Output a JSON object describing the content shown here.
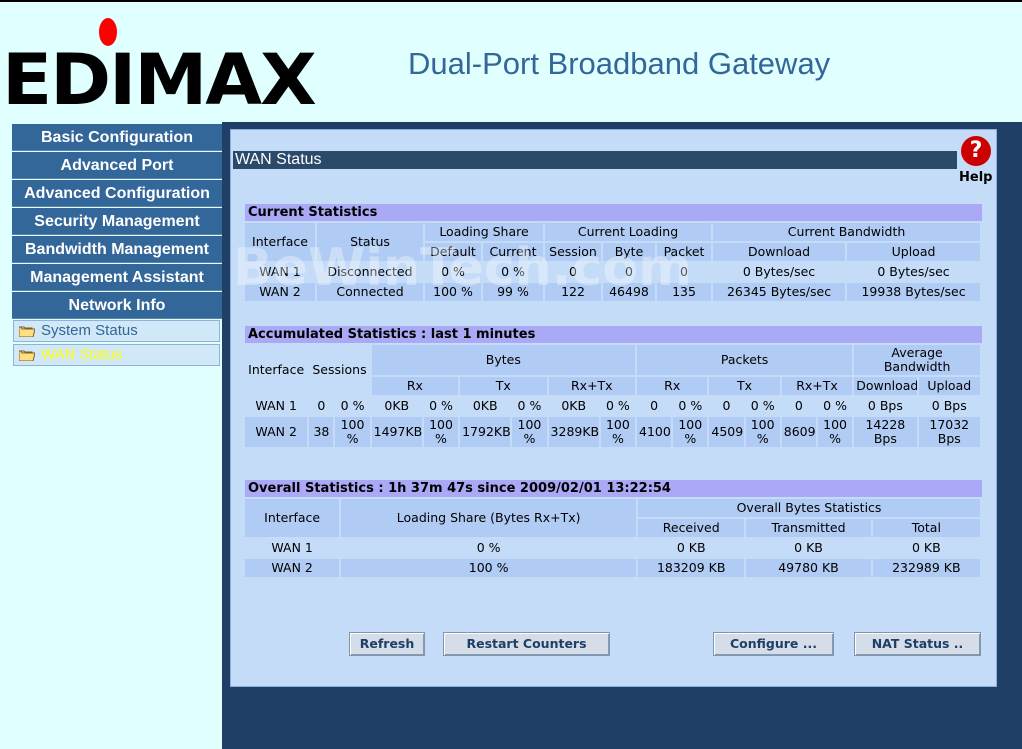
{
  "brand": {
    "logo_text": "EDIMAX",
    "logo_dot_color": "#ff0000"
  },
  "page_title": "Dual-Port Broadband Gateway",
  "sidebar": {
    "items": [
      {
        "label": "Basic Configuration"
      },
      {
        "label": "Advanced Port"
      },
      {
        "label": "Advanced Configuration"
      },
      {
        "label": "Security Management"
      },
      {
        "label": "Bandwidth Management"
      },
      {
        "label": "Management Assistant"
      },
      {
        "label": "Network Info"
      }
    ],
    "subitems": [
      {
        "label": "System Status",
        "icon": "folder-icon",
        "color": "#336699"
      },
      {
        "label": "WAN Status",
        "icon": "folder-icon",
        "color": "#ffff00"
      }
    ]
  },
  "panel": {
    "title": "WAN Status",
    "help_label": "Help",
    "help_icon": "?"
  },
  "current_statistics": {
    "title": "Current Statistics",
    "headers": {
      "interface": "Interface",
      "status": "Status",
      "loading_share": "Loading Share",
      "default": "Default",
      "current": "Current",
      "current_loading": "Current Loading",
      "session": "Session",
      "byte": "Byte",
      "packet": "Packet",
      "current_bandwidth": "Current Bandwidth",
      "download": "Download",
      "upload": "Upload"
    },
    "rows": [
      {
        "interface": "WAN 1",
        "status": "Disconnected",
        "default": "0 %",
        "current": "0 %",
        "session": "0",
        "byte": "0",
        "packet": "0",
        "download": "0 Bytes/sec",
        "upload": "0 Bytes/sec"
      },
      {
        "interface": "WAN 2",
        "status": "Connected",
        "default": "100 %",
        "current": "99 %",
        "session": "122",
        "byte": "46498",
        "packet": "135",
        "download": "26345 Bytes/sec",
        "upload": "19938 Bytes/sec"
      }
    ]
  },
  "accumulated_statistics": {
    "title": "Accumulated Statistics : last 1 minutes",
    "headers": {
      "interface": "Interface",
      "sessions": "Sessions",
      "bytes": "Bytes",
      "packets": "Packets",
      "average_bandwidth": "Average Bandwidth",
      "rx": "Rx",
      "tx": "Tx",
      "rxtx": "Rx+Tx",
      "download": "Download",
      "upload": "Upload"
    },
    "rows": [
      {
        "interface": "WAN 1",
        "sessions": "0",
        "sessions_pct": "0 %",
        "bytes_rx": "0KB",
        "bytes_rx_pct": "0 %",
        "bytes_tx": "0KB",
        "bytes_tx_pct": "0 %",
        "bytes_rxtx": "0KB",
        "bytes_rxtx_pct": "0 %",
        "pkt_rx": "0",
        "pkt_rx_pct": "0 %",
        "pkt_tx": "0",
        "pkt_tx_pct": "0 %",
        "pkt_rxtx": "0",
        "pkt_rxtx_pct": "0 %",
        "download": "0 Bps",
        "upload": "0 Bps"
      },
      {
        "interface": "WAN 2",
        "sessions": "38",
        "sessions_pct": "100 %",
        "bytes_rx": "1497KB",
        "bytes_rx_pct": "100 %",
        "bytes_tx": "1792KB",
        "bytes_tx_pct": "100 %",
        "bytes_rxtx": "3289KB",
        "bytes_rxtx_pct": "100 %",
        "pkt_rx": "4100",
        "pkt_rx_pct": "100 %",
        "pkt_tx": "4509",
        "pkt_tx_pct": "100 %",
        "pkt_rxtx": "8609",
        "pkt_rxtx_pct": "100 %",
        "download": "14228 Bps",
        "upload": "17032 Bps"
      }
    ]
  },
  "overall_statistics": {
    "title": "Overall Statistics : 1h 37m 47s since 2009/02/01 13:22:54",
    "headers": {
      "interface": "Interface",
      "loading_share": "Loading Share (Bytes Rx+Tx)",
      "overall_bytes": "Overall Bytes Statistics",
      "received": "Received",
      "transmitted": "Transmitted",
      "total": "Total"
    },
    "rows": [
      {
        "interface": "WAN 1",
        "loading_share": "0 %",
        "received": "0 KB",
        "transmitted": "0 KB",
        "total": "0 KB"
      },
      {
        "interface": "WAN 2",
        "loading_share": "100 %",
        "received": "183209 KB",
        "transmitted": "49780 KB",
        "total": "232989 KB"
      }
    ]
  },
  "buttons": {
    "refresh": "Refresh",
    "restart_counters": "Restart Counters",
    "configure": "Configure ...",
    "nat_status": "NAT Status .."
  },
  "watermark": "BeWinTech.com"
}
